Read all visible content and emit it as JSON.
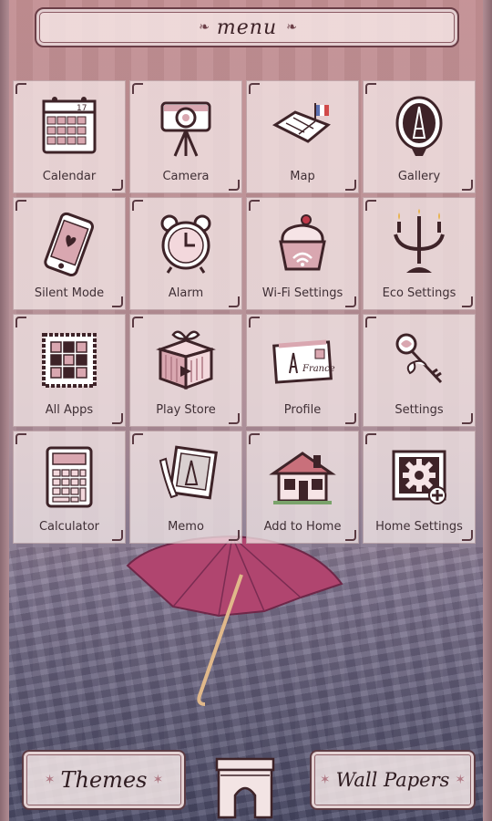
{
  "menu": {
    "title": "menu"
  },
  "apps": [
    {
      "label": "Calendar",
      "icon": "calendar-icon"
    },
    {
      "label": "Camera",
      "icon": "camera-icon"
    },
    {
      "label": "Map",
      "icon": "map-icon"
    },
    {
      "label": "Gallery",
      "icon": "gallery-icon"
    },
    {
      "label": "Silent Mode",
      "icon": "phone-icon"
    },
    {
      "label": "Alarm",
      "icon": "alarm-clock-icon"
    },
    {
      "label": "Wi-Fi Settings",
      "icon": "cupcake-wifi-icon"
    },
    {
      "label": "Eco Settings",
      "icon": "candelabra-icon"
    },
    {
      "label": "All Apps",
      "icon": "grid-stamp-icon"
    },
    {
      "label": "Play Store",
      "icon": "gift-box-icon"
    },
    {
      "label": "Profile",
      "icon": "postcard-icon"
    },
    {
      "label": "Settings",
      "icon": "key-ribbon-icon"
    },
    {
      "label": "Calculator",
      "icon": "calculator-icon"
    },
    {
      "label": "Memo",
      "icon": "memo-photo-icon"
    },
    {
      "label": "Add to Home",
      "icon": "house-icon"
    },
    {
      "label": "Home Settings",
      "icon": "gear-frame-icon"
    }
  ],
  "calendar_text": "17",
  "profile_text": "France",
  "bottom": {
    "themes_label": "Themes",
    "wallpapers_label": "Wall Papers"
  },
  "colors": {
    "ink": "#3e2328",
    "tile_bg": "#f5e9ea",
    "pink": "#d9a7b0",
    "umbrella": "#b0456f"
  }
}
